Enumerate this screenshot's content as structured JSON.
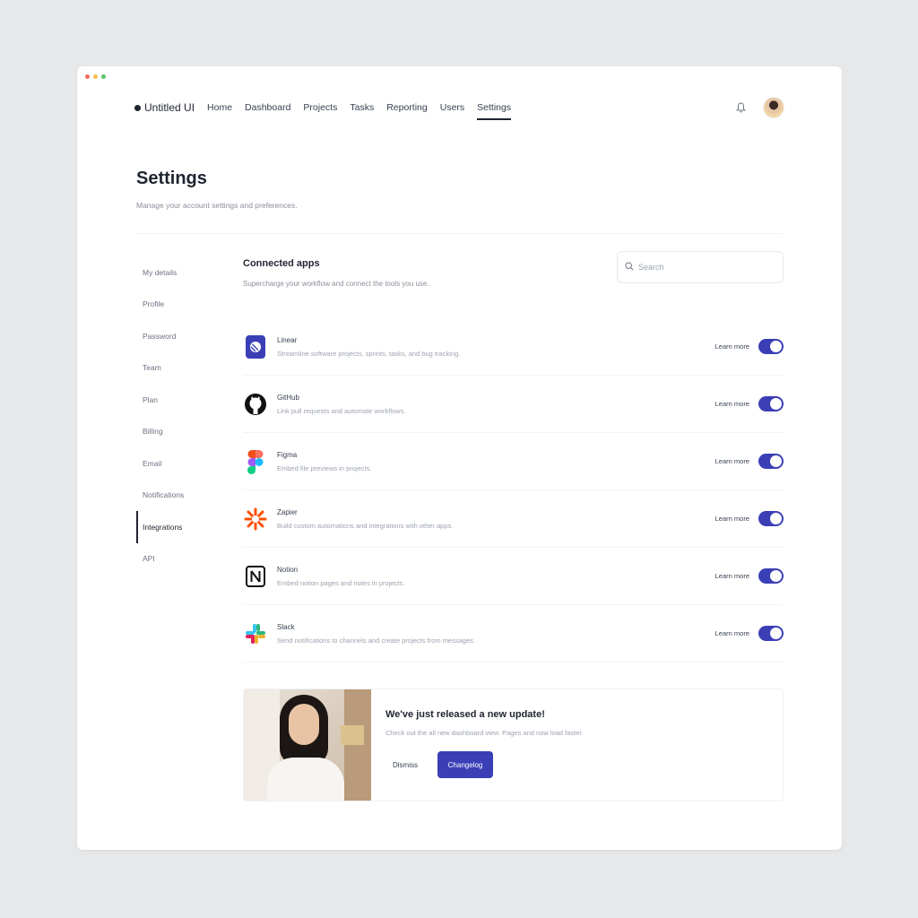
{
  "nav": {
    "brand": "Untitled UI",
    "items": [
      "Home",
      "Dashboard",
      "Projects",
      "Tasks",
      "Reporting",
      "Users",
      "Settings"
    ],
    "active": "Settings"
  },
  "page": {
    "title": "Settings",
    "subtitle": "Manage your account settings and preferences."
  },
  "side_menu": {
    "items": [
      "My details",
      "Profile",
      "Password",
      "Team",
      "Plan",
      "Billing",
      "Email",
      "Notifications",
      "Integrations",
      "API"
    ],
    "active": "Integrations"
  },
  "connected": {
    "title": "Connected apps",
    "subtitle": "Supercharge your workflow and connect the tools you use.",
    "search_placeholder": "Search"
  },
  "apps": [
    {
      "name": "Linear",
      "desc": "Streamline software projects, sprints, tasks, and bug tracking.",
      "learn": "Learn more",
      "enabled": true,
      "icon": "linear-icon"
    },
    {
      "name": "GitHub",
      "desc": "Link pull requests and automate workflows.",
      "learn": "Learn more",
      "enabled": true,
      "icon": "github-icon"
    },
    {
      "name": "Figma",
      "desc": "Embed file previews in projects.",
      "learn": "Learn more",
      "enabled": true,
      "icon": "figma-icon"
    },
    {
      "name": "Zapier",
      "desc": "Build custom automations and integrations with other apps.",
      "learn": "Learn more",
      "enabled": true,
      "icon": "zapier-icon"
    },
    {
      "name": "Notion",
      "desc": "Embed notion pages and notes in projects.",
      "learn": "Learn more",
      "enabled": true,
      "icon": "notion-icon"
    },
    {
      "name": "Slack",
      "desc": "Send notifications to channels and create projects from messages.",
      "learn": "Learn more",
      "enabled": true,
      "icon": "slack-icon"
    }
  ],
  "banner": {
    "title": "We've just released a new update!",
    "text": "Check out the all new dashboard view. Pages and now load faster.",
    "dismiss": "Dismiss",
    "changelog": "Changelog"
  },
  "colors": {
    "accent": "#3b3fb6",
    "text": "#1f2430",
    "muted": "#8a8f99"
  }
}
